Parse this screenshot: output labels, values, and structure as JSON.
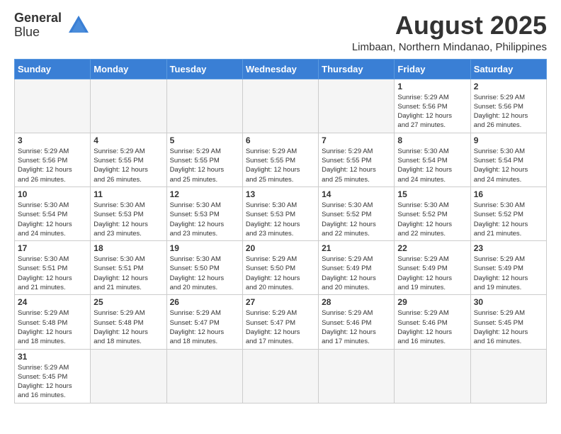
{
  "logo": {
    "text_general": "General",
    "text_blue": "Blue"
  },
  "title": {
    "month_year": "August 2025",
    "location": "Limbaan, Northern Mindanao, Philippines"
  },
  "weekdays": [
    "Sunday",
    "Monday",
    "Tuesday",
    "Wednesday",
    "Thursday",
    "Friday",
    "Saturday"
  ],
  "weeks": [
    [
      {
        "day": "",
        "info": ""
      },
      {
        "day": "",
        "info": ""
      },
      {
        "day": "",
        "info": ""
      },
      {
        "day": "",
        "info": ""
      },
      {
        "day": "",
        "info": ""
      },
      {
        "day": "1",
        "info": "Sunrise: 5:29 AM\nSunset: 5:56 PM\nDaylight: 12 hours\nand 27 minutes."
      },
      {
        "day": "2",
        "info": "Sunrise: 5:29 AM\nSunset: 5:56 PM\nDaylight: 12 hours\nand 26 minutes."
      }
    ],
    [
      {
        "day": "3",
        "info": "Sunrise: 5:29 AM\nSunset: 5:56 PM\nDaylight: 12 hours\nand 26 minutes."
      },
      {
        "day": "4",
        "info": "Sunrise: 5:29 AM\nSunset: 5:55 PM\nDaylight: 12 hours\nand 26 minutes."
      },
      {
        "day": "5",
        "info": "Sunrise: 5:29 AM\nSunset: 5:55 PM\nDaylight: 12 hours\nand 25 minutes."
      },
      {
        "day": "6",
        "info": "Sunrise: 5:29 AM\nSunset: 5:55 PM\nDaylight: 12 hours\nand 25 minutes."
      },
      {
        "day": "7",
        "info": "Sunrise: 5:29 AM\nSunset: 5:55 PM\nDaylight: 12 hours\nand 25 minutes."
      },
      {
        "day": "8",
        "info": "Sunrise: 5:30 AM\nSunset: 5:54 PM\nDaylight: 12 hours\nand 24 minutes."
      },
      {
        "day": "9",
        "info": "Sunrise: 5:30 AM\nSunset: 5:54 PM\nDaylight: 12 hours\nand 24 minutes."
      }
    ],
    [
      {
        "day": "10",
        "info": "Sunrise: 5:30 AM\nSunset: 5:54 PM\nDaylight: 12 hours\nand 24 minutes."
      },
      {
        "day": "11",
        "info": "Sunrise: 5:30 AM\nSunset: 5:53 PM\nDaylight: 12 hours\nand 23 minutes."
      },
      {
        "day": "12",
        "info": "Sunrise: 5:30 AM\nSunset: 5:53 PM\nDaylight: 12 hours\nand 23 minutes."
      },
      {
        "day": "13",
        "info": "Sunrise: 5:30 AM\nSunset: 5:53 PM\nDaylight: 12 hours\nand 23 minutes."
      },
      {
        "day": "14",
        "info": "Sunrise: 5:30 AM\nSunset: 5:52 PM\nDaylight: 12 hours\nand 22 minutes."
      },
      {
        "day": "15",
        "info": "Sunrise: 5:30 AM\nSunset: 5:52 PM\nDaylight: 12 hours\nand 22 minutes."
      },
      {
        "day": "16",
        "info": "Sunrise: 5:30 AM\nSunset: 5:52 PM\nDaylight: 12 hours\nand 21 minutes."
      }
    ],
    [
      {
        "day": "17",
        "info": "Sunrise: 5:30 AM\nSunset: 5:51 PM\nDaylight: 12 hours\nand 21 minutes."
      },
      {
        "day": "18",
        "info": "Sunrise: 5:30 AM\nSunset: 5:51 PM\nDaylight: 12 hours\nand 21 minutes."
      },
      {
        "day": "19",
        "info": "Sunrise: 5:30 AM\nSunset: 5:50 PM\nDaylight: 12 hours\nand 20 minutes."
      },
      {
        "day": "20",
        "info": "Sunrise: 5:29 AM\nSunset: 5:50 PM\nDaylight: 12 hours\nand 20 minutes."
      },
      {
        "day": "21",
        "info": "Sunrise: 5:29 AM\nSunset: 5:49 PM\nDaylight: 12 hours\nand 20 minutes."
      },
      {
        "day": "22",
        "info": "Sunrise: 5:29 AM\nSunset: 5:49 PM\nDaylight: 12 hours\nand 19 minutes."
      },
      {
        "day": "23",
        "info": "Sunrise: 5:29 AM\nSunset: 5:49 PM\nDaylight: 12 hours\nand 19 minutes."
      }
    ],
    [
      {
        "day": "24",
        "info": "Sunrise: 5:29 AM\nSunset: 5:48 PM\nDaylight: 12 hours\nand 18 minutes."
      },
      {
        "day": "25",
        "info": "Sunrise: 5:29 AM\nSunset: 5:48 PM\nDaylight: 12 hours\nand 18 minutes."
      },
      {
        "day": "26",
        "info": "Sunrise: 5:29 AM\nSunset: 5:47 PM\nDaylight: 12 hours\nand 18 minutes."
      },
      {
        "day": "27",
        "info": "Sunrise: 5:29 AM\nSunset: 5:47 PM\nDaylight: 12 hours\nand 17 minutes."
      },
      {
        "day": "28",
        "info": "Sunrise: 5:29 AM\nSunset: 5:46 PM\nDaylight: 12 hours\nand 17 minutes."
      },
      {
        "day": "29",
        "info": "Sunrise: 5:29 AM\nSunset: 5:46 PM\nDaylight: 12 hours\nand 16 minutes."
      },
      {
        "day": "30",
        "info": "Sunrise: 5:29 AM\nSunset: 5:45 PM\nDaylight: 12 hours\nand 16 minutes."
      }
    ],
    [
      {
        "day": "31",
        "info": "Sunrise: 5:29 AM\nSunset: 5:45 PM\nDaylight: 12 hours\nand 16 minutes."
      },
      {
        "day": "",
        "info": ""
      },
      {
        "day": "",
        "info": ""
      },
      {
        "day": "",
        "info": ""
      },
      {
        "day": "",
        "info": ""
      },
      {
        "day": "",
        "info": ""
      },
      {
        "day": "",
        "info": ""
      }
    ]
  ]
}
